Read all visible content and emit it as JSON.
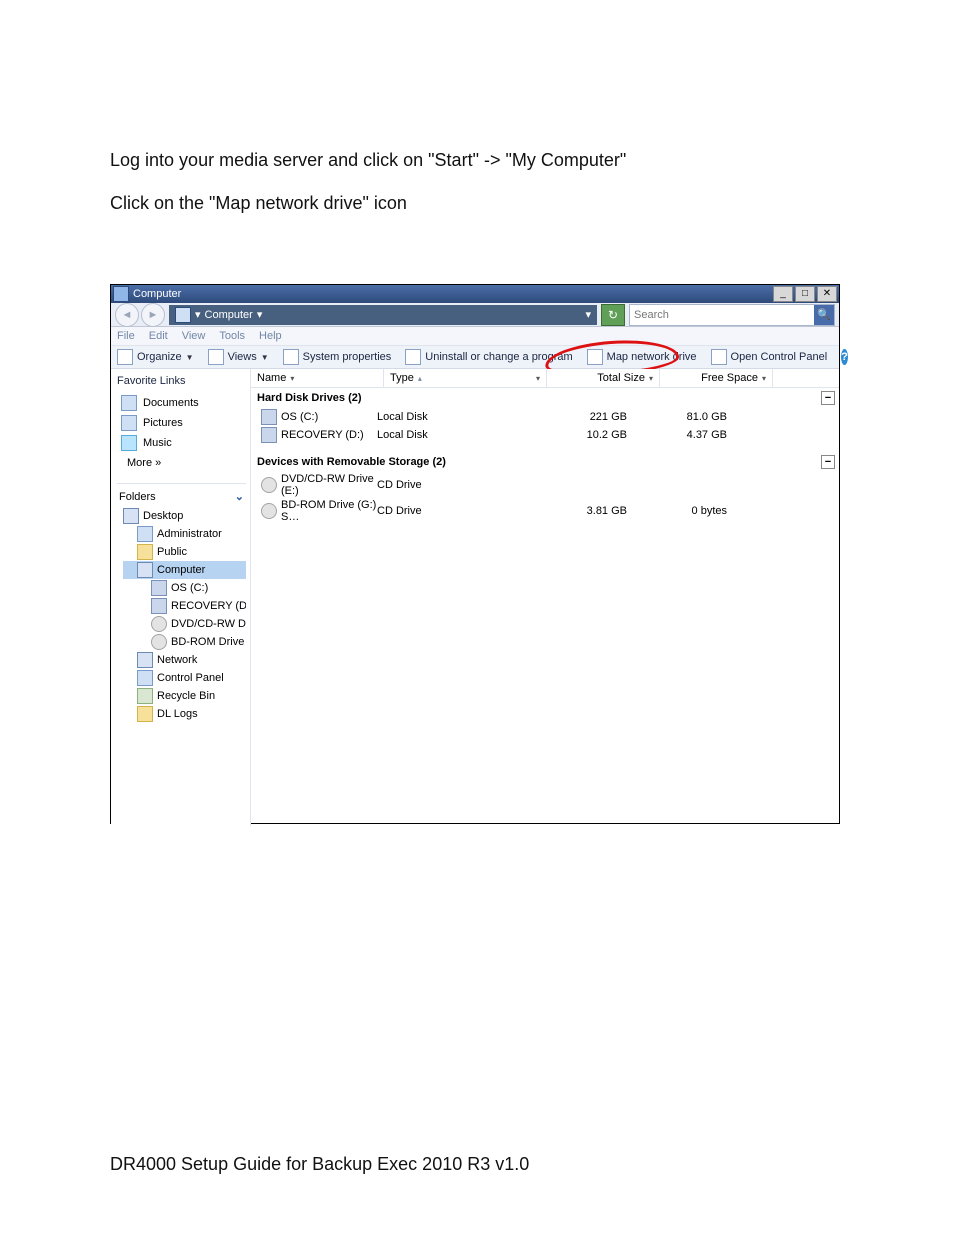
{
  "instructions": {
    "line1": "Log into your media server and click on \"Start\" -> \"My Computer\"",
    "line2": "Click on the \"Map network drive\" icon"
  },
  "footer": "DR4000 Setup Guide for Backup Exec 2010 R3 v1.0",
  "window": {
    "title": "Computer",
    "breadcrumb": "Computer",
    "search_placeholder": "Search",
    "menu": [
      "File",
      "Edit",
      "View",
      "Tools",
      "Help"
    ],
    "toolbar": {
      "organize": "Organize",
      "views": "Views",
      "sysprops": "System properties",
      "uninstall": "Uninstall or change a program",
      "mapdrive": "Map network drive",
      "controlpanel": "Open Control Panel"
    },
    "columns": {
      "name": "Name",
      "type": "Type",
      "totalsize": "Total Size",
      "freespace": "Free Space"
    },
    "groups": {
      "hdd": "Hard Disk Drives (2)",
      "removable": "Devices with Removable Storage (2)"
    },
    "drives": {
      "osc": {
        "name": "OS (C:)",
        "type": "Local Disk",
        "size": "221 GB",
        "free": "81.0 GB"
      },
      "recd": {
        "name": "RECOVERY (D:)",
        "type": "Local Disk",
        "size": "10.2 GB",
        "free": "4.37 GB"
      },
      "dvde": {
        "name": "DVD/CD-RW Drive (E:)",
        "type": "CD Drive",
        "size": "",
        "free": ""
      },
      "bdg": {
        "name": "BD-ROM Drive (G:) S…",
        "type": "CD Drive",
        "size": "3.81 GB",
        "free": "0 bytes"
      }
    },
    "sidebar": {
      "favorites_label": "Favorite Links",
      "documents": "Documents",
      "pictures": "Pictures",
      "music": "Music",
      "more": "More  »",
      "folders_label": "Folders",
      "tree": {
        "desktop": "Desktop",
        "administrator": "Administrator",
        "public": "Public",
        "computer": "Computer",
        "osc": "OS (C:)",
        "recd": "RECOVERY (D:)",
        "dvde": "DVD/CD-RW Drive (",
        "bdg": "BD-ROM Drive (G:) S",
        "network": "Network",
        "controlpanel": "Control Panel",
        "recyclebin": "Recycle Bin",
        "dllogs": "DL Logs"
      }
    }
  }
}
